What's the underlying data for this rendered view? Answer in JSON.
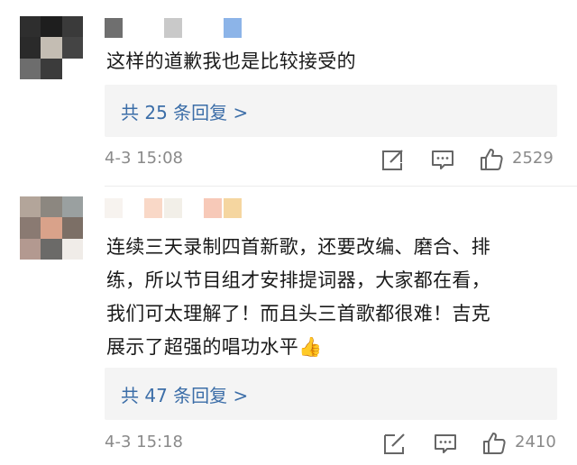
{
  "comments": [
    {
      "text": "这样的道歉我也是比较接受的",
      "replies_label": "共 25 条回复 >",
      "time": "4-3 15:08",
      "likes": "2529",
      "avatar_colors": [
        "#2e2e2e",
        "#1e1e1e",
        "#3a3a3a",
        "#2a2a2a",
        "#c4bdb3",
        "#444444",
        "#6d6d6d",
        "#3b3b3b",
        "#ffffff"
      ],
      "name_colors": [
        "#6f6f6f",
        "#ffffff",
        "#ffffff",
        "#c9c9c9",
        "#ffffff",
        "#ffffff",
        "#8cb4e8"
      ]
    },
    {
      "text_lines": [
        "连续三天录制四首新歌，还要改编、磨合、排",
        "练，所以节目组才安排提词器，大家都在看，",
        "我们可太理解了！而且头三首歌都很难！吉克",
        "展示了超强的唱功水平"
      ],
      "emoji": "👍",
      "replies_label": "共 47 条回复 >",
      "time": "4-3 15:18",
      "likes": "2410",
      "avatar_colors": [
        "#b3a59a",
        "#8c8780",
        "#9aa0a0",
        "#8a7a72",
        "#d9a28a",
        "#7c6f66",
        "#b39990",
        "#6b6a68",
        "#f0ece8"
      ],
      "name_colors": [
        "#f7f3ef",
        "#ffffff",
        "#f9d8c7",
        "#f2efe8",
        "#ffffff",
        "#f7c9b8",
        "#f5d6a0"
      ]
    }
  ],
  "icons": {
    "edit": "edit-icon",
    "comment": "comment-icon",
    "like": "thumbs-up-icon"
  }
}
